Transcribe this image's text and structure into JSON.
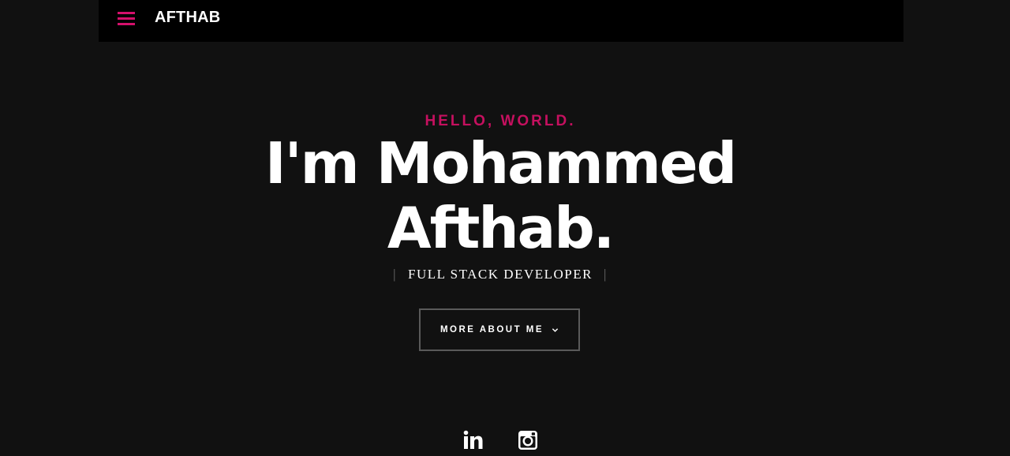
{
  "header": {
    "logo": "AFTHAB",
    "menu_icon": "hamburger-menu-icon"
  },
  "hero": {
    "greeting": "HELLO, WORLD.",
    "headline_line1": "I'm Mohammed",
    "headline_line2": "Afthab.",
    "subtitle": "FULL STACK DEVELOPER",
    "divider": "|",
    "cta_label": "MORE ABOUT ME",
    "cta_icon": "chevron-down-icon"
  },
  "social": {
    "items": [
      {
        "icon": "linkedin-icon"
      },
      {
        "icon": "instagram-icon"
      }
    ]
  },
  "colors": {
    "background": "#111111",
    "topbar": "#000000",
    "accent": "#d4106b",
    "text": "#ffffff",
    "button_border": "#5a5a5a"
  }
}
